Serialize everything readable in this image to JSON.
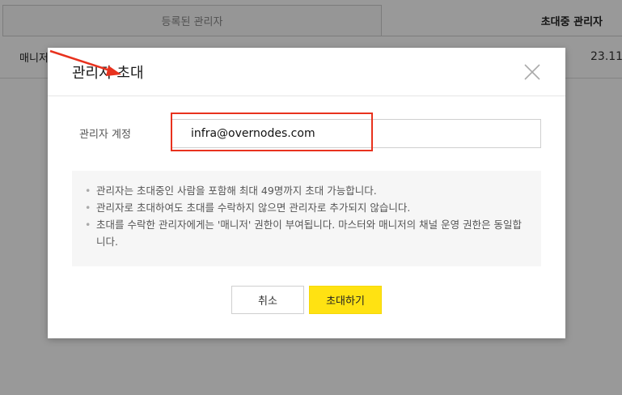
{
  "background": {
    "tabs": [
      {
        "label": "등록된 관리자"
      },
      {
        "label": "초대중 관리자"
      }
    ],
    "row": {
      "role": "매니저",
      "date": "23.11."
    }
  },
  "modal": {
    "title": "관리자 초대",
    "field_label": "관리자 계정",
    "email_value": "infra@overnodes.com",
    "notices": [
      "관리자는 초대중인 사람을 포함해 최대 49명까지 초대 가능합니다.",
      "관리자로 초대하여도 초대를 수락하지 않으면 관리자로 추가되지 않습니다.",
      "초대를 수락한 관리자에게는 '매니저' 권한이 부여됩니다. 마스터와 매니저의 채널 운영 권한은 동일합니다."
    ],
    "cancel_label": "취소",
    "invite_label": "초대하기",
    "close_icon": "close-icon"
  },
  "colors": {
    "invite_button": "#ffe212",
    "highlight": "#e8321e",
    "overlay": "rgba(0,0,0,0.4)"
  }
}
